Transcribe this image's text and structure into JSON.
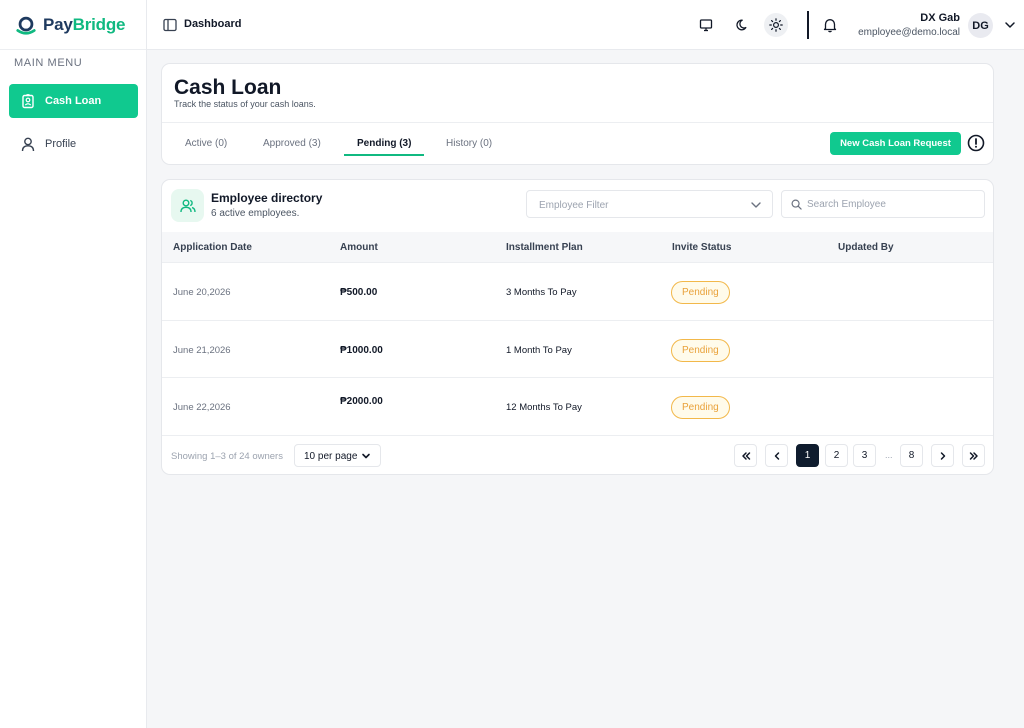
{
  "brand": {
    "name_part1": "Pay",
    "name_part2": "Bridge"
  },
  "sidebar": {
    "heading": "MAIN MENU",
    "items": [
      {
        "label": "Cash Loan",
        "icon": "id-badge-icon",
        "active": true
      },
      {
        "label": "Profile",
        "icon": "user-icon",
        "active": false
      }
    ]
  },
  "header": {
    "breadcrumb": "Dashboard",
    "user": {
      "name": "DX Gab",
      "email": "employee@demo.local",
      "initials": "DG"
    }
  },
  "page": {
    "title": "Cash Loan",
    "subtitle": "Track the status of your cash loans.",
    "tabs": [
      {
        "label": "Active (0)"
      },
      {
        "label": "Approved (3)"
      },
      {
        "label": "Pending (3)",
        "active": true
      },
      {
        "label": "History (0)"
      }
    ],
    "new_request_label": "New Cash Loan Request"
  },
  "directory": {
    "title": "Employee directory",
    "subtitle": "6 active employees.",
    "filter_placeholder": "Employee Filter",
    "search_placeholder": "Search Employee",
    "columns": [
      "Application Date",
      "Amount",
      "Installment Plan",
      "Invite Status",
      "Updated By"
    ],
    "rows": [
      {
        "date": "June 20,2026",
        "amount": "₱500.00",
        "plan": "3 Months To Pay",
        "status": "Pending",
        "updated_by": ""
      },
      {
        "date": "June 21,2026",
        "amount": "₱1000.00",
        "plan": "1 Month To Pay",
        "status": "Pending",
        "updated_by": ""
      },
      {
        "date": "June 22,2026",
        "amount": "₱2000.00",
        "plan": "12 Months To Pay",
        "status": "Pending",
        "updated_by": ""
      }
    ],
    "footer": {
      "showing": "Showing 1–3 of 24 owners",
      "per_page": "10 per page",
      "pages": [
        "1",
        "2",
        "3",
        "8"
      ],
      "ellipsis": "...",
      "current_page": "1"
    }
  },
  "colors": {
    "accent": "#10c98f",
    "pending": "#e9a23b",
    "dark": "#0f1c2e"
  }
}
